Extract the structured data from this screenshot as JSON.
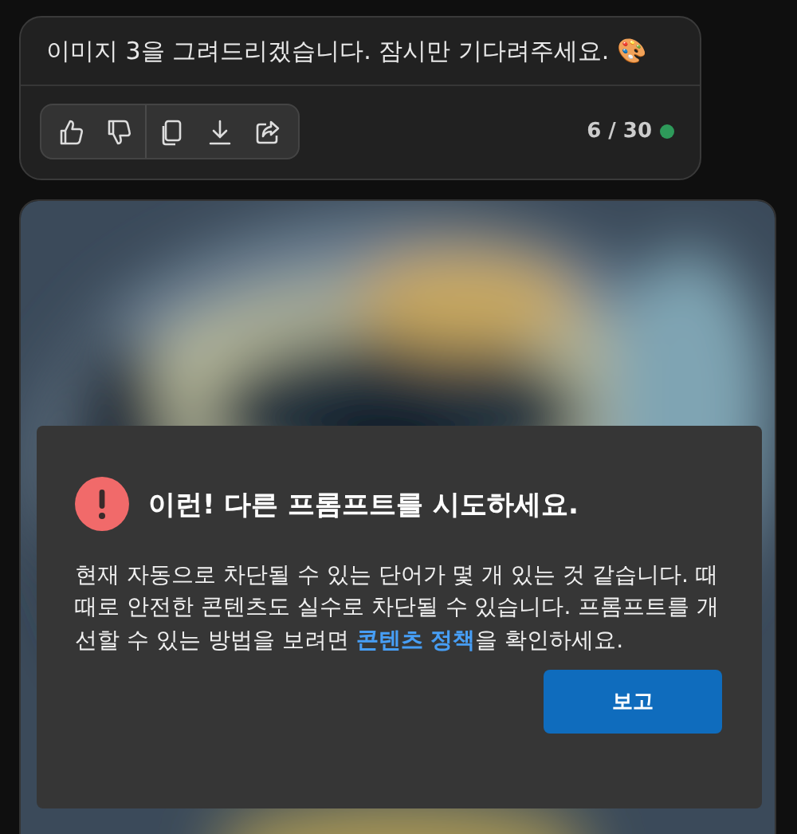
{
  "message": {
    "text": "이미지 3을 그려드리겠습니다. 잠시만 기다려주세요. 🎨",
    "count": "6 / 30"
  },
  "dialog": {
    "title": "이런! 다른 프롬프트를 시도하세요.",
    "body_before": "현재 자동으로 차단될 수 있는 단어가 몇 개 있는 것 같습니다. 때때로 안전한 콘텐츠도 실수로 차단될 수 있습니다. 프롬프트를 개선할 수 있는 방법을 보려면 ",
    "link": "콘텐츠 정책",
    "body_after": "을 확인하세요.",
    "button": "보고"
  }
}
